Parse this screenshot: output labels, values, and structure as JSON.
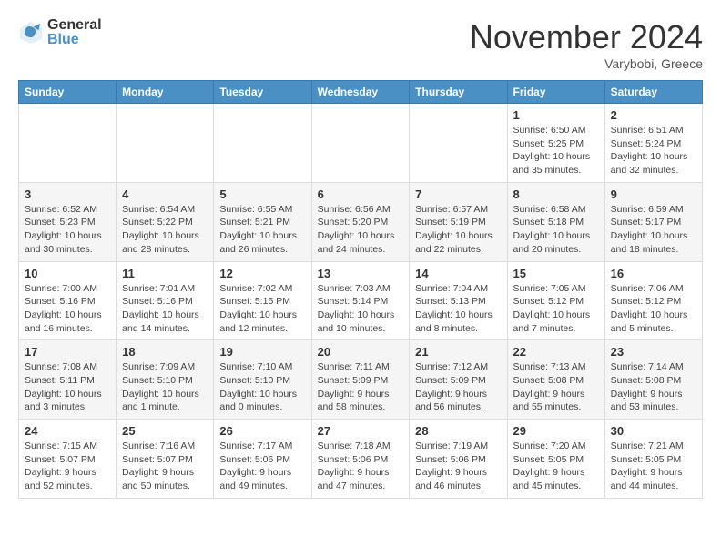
{
  "logo": {
    "general": "General",
    "blue": "Blue"
  },
  "header": {
    "month": "November 2024",
    "location": "Varybobi, Greece"
  },
  "weekdays": [
    "Sunday",
    "Monday",
    "Tuesday",
    "Wednesday",
    "Thursday",
    "Friday",
    "Saturday"
  ],
  "weeks": [
    [
      {
        "day": "",
        "info": ""
      },
      {
        "day": "",
        "info": ""
      },
      {
        "day": "",
        "info": ""
      },
      {
        "day": "",
        "info": ""
      },
      {
        "day": "",
        "info": ""
      },
      {
        "day": "1",
        "info": "Sunrise: 6:50 AM\nSunset: 5:25 PM\nDaylight: 10 hours and 35 minutes."
      },
      {
        "day": "2",
        "info": "Sunrise: 6:51 AM\nSunset: 5:24 PM\nDaylight: 10 hours and 32 minutes."
      }
    ],
    [
      {
        "day": "3",
        "info": "Sunrise: 6:52 AM\nSunset: 5:23 PM\nDaylight: 10 hours and 30 minutes."
      },
      {
        "day": "4",
        "info": "Sunrise: 6:54 AM\nSunset: 5:22 PM\nDaylight: 10 hours and 28 minutes."
      },
      {
        "day": "5",
        "info": "Sunrise: 6:55 AM\nSunset: 5:21 PM\nDaylight: 10 hours and 26 minutes."
      },
      {
        "day": "6",
        "info": "Sunrise: 6:56 AM\nSunset: 5:20 PM\nDaylight: 10 hours and 24 minutes."
      },
      {
        "day": "7",
        "info": "Sunrise: 6:57 AM\nSunset: 5:19 PM\nDaylight: 10 hours and 22 minutes."
      },
      {
        "day": "8",
        "info": "Sunrise: 6:58 AM\nSunset: 5:18 PM\nDaylight: 10 hours and 20 minutes."
      },
      {
        "day": "9",
        "info": "Sunrise: 6:59 AM\nSunset: 5:17 PM\nDaylight: 10 hours and 18 minutes."
      }
    ],
    [
      {
        "day": "10",
        "info": "Sunrise: 7:00 AM\nSunset: 5:16 PM\nDaylight: 10 hours and 16 minutes."
      },
      {
        "day": "11",
        "info": "Sunrise: 7:01 AM\nSunset: 5:16 PM\nDaylight: 10 hours and 14 minutes."
      },
      {
        "day": "12",
        "info": "Sunrise: 7:02 AM\nSunset: 5:15 PM\nDaylight: 10 hours and 12 minutes."
      },
      {
        "day": "13",
        "info": "Sunrise: 7:03 AM\nSunset: 5:14 PM\nDaylight: 10 hours and 10 minutes."
      },
      {
        "day": "14",
        "info": "Sunrise: 7:04 AM\nSunset: 5:13 PM\nDaylight: 10 hours and 8 minutes."
      },
      {
        "day": "15",
        "info": "Sunrise: 7:05 AM\nSunset: 5:12 PM\nDaylight: 10 hours and 7 minutes."
      },
      {
        "day": "16",
        "info": "Sunrise: 7:06 AM\nSunset: 5:12 PM\nDaylight: 10 hours and 5 minutes."
      }
    ],
    [
      {
        "day": "17",
        "info": "Sunrise: 7:08 AM\nSunset: 5:11 PM\nDaylight: 10 hours and 3 minutes."
      },
      {
        "day": "18",
        "info": "Sunrise: 7:09 AM\nSunset: 5:10 PM\nDaylight: 10 hours and 1 minute."
      },
      {
        "day": "19",
        "info": "Sunrise: 7:10 AM\nSunset: 5:10 PM\nDaylight: 10 hours and 0 minutes."
      },
      {
        "day": "20",
        "info": "Sunrise: 7:11 AM\nSunset: 5:09 PM\nDaylight: 9 hours and 58 minutes."
      },
      {
        "day": "21",
        "info": "Sunrise: 7:12 AM\nSunset: 5:09 PM\nDaylight: 9 hours and 56 minutes."
      },
      {
        "day": "22",
        "info": "Sunrise: 7:13 AM\nSunset: 5:08 PM\nDaylight: 9 hours and 55 minutes."
      },
      {
        "day": "23",
        "info": "Sunrise: 7:14 AM\nSunset: 5:08 PM\nDaylight: 9 hours and 53 minutes."
      }
    ],
    [
      {
        "day": "24",
        "info": "Sunrise: 7:15 AM\nSunset: 5:07 PM\nDaylight: 9 hours and 52 minutes."
      },
      {
        "day": "25",
        "info": "Sunrise: 7:16 AM\nSunset: 5:07 PM\nDaylight: 9 hours and 50 minutes."
      },
      {
        "day": "26",
        "info": "Sunrise: 7:17 AM\nSunset: 5:06 PM\nDaylight: 9 hours and 49 minutes."
      },
      {
        "day": "27",
        "info": "Sunrise: 7:18 AM\nSunset: 5:06 PM\nDaylight: 9 hours and 47 minutes."
      },
      {
        "day": "28",
        "info": "Sunrise: 7:19 AM\nSunset: 5:06 PM\nDaylight: 9 hours and 46 minutes."
      },
      {
        "day": "29",
        "info": "Sunrise: 7:20 AM\nSunset: 5:05 PM\nDaylight: 9 hours and 45 minutes."
      },
      {
        "day": "30",
        "info": "Sunrise: 7:21 AM\nSunset: 5:05 PM\nDaylight: 9 hours and 44 minutes."
      }
    ]
  ]
}
